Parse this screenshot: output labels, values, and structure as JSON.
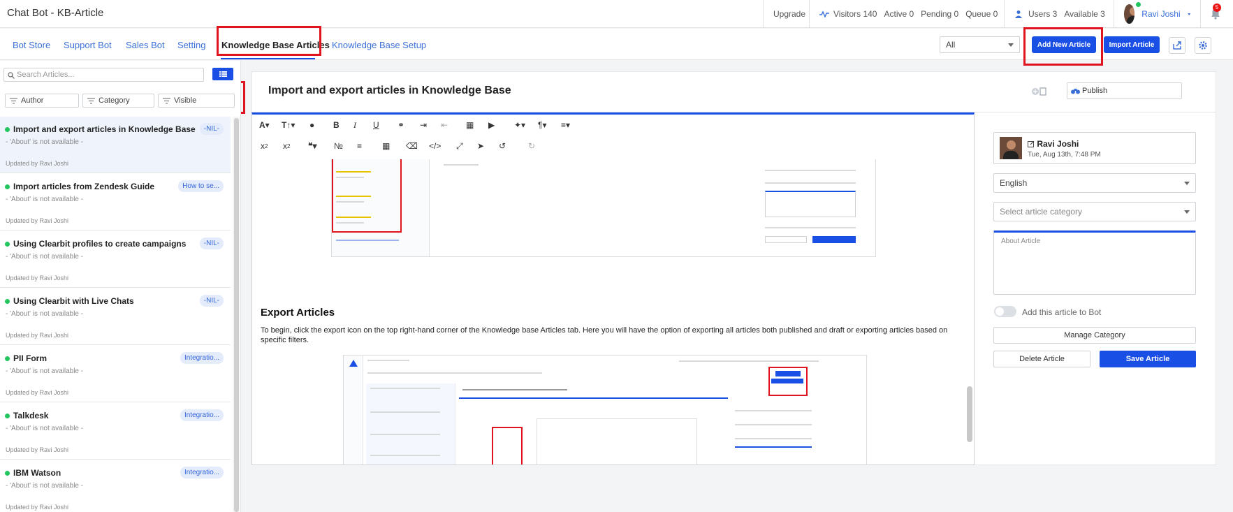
{
  "app": {
    "title": "Chat Bot - KB-Article"
  },
  "topbar": {
    "upgrade": "Upgrade",
    "visitors": "Visitors 140",
    "active": "Active 0",
    "pending": "Pending 0",
    "queue": "Queue 0",
    "users": "Users 3",
    "available": "Available 3",
    "user_name": "Ravi Joshi",
    "notifications": "5"
  },
  "tabs": [
    {
      "label": "Bot Store"
    },
    {
      "label": "Support Bot"
    },
    {
      "label": "Sales Bot"
    },
    {
      "label": "Setting"
    },
    {
      "label": "Knowledge Base Articles"
    },
    {
      "label": "Knowledge Base Setup"
    }
  ],
  "header_actions": {
    "filter_value": "All",
    "add_new_article": "Add New Article",
    "import_article": "Import Article"
  },
  "sidebar": {
    "search_placeholder": "Search Articles...",
    "filters": {
      "author": "Author",
      "category": "Category",
      "visible": "Visible"
    },
    "articles": [
      {
        "title": "Import and export articles in Knowledge Base",
        "badge": "-NIL-",
        "about": "- 'About' is not available -",
        "updated": "Updated by Ravi Joshi"
      },
      {
        "title": "Import articles from Zendesk Guide",
        "badge": "How to se...",
        "about": "- 'About' is not available -",
        "updated": "Updated by Ravi Joshi"
      },
      {
        "title": "Using Clearbit profiles to create campaigns",
        "badge": "-NIL-",
        "about": "- 'About' is not available -",
        "updated": "Updated by Ravi Joshi"
      },
      {
        "title": "Using Clearbit with Live Chats",
        "badge": "-NIL-",
        "about": "- 'About' is not available -",
        "updated": "Updated by Ravi Joshi"
      },
      {
        "title": "PII Form",
        "badge": "Integratio...",
        "about": "- 'About' is not available -",
        "updated": "Updated by Ravi Joshi"
      },
      {
        "title": "Talkdesk",
        "badge": "Integratio...",
        "about": "- 'About' is not available -",
        "updated": "Updated by Ravi Joshi"
      },
      {
        "title": "IBM Watson",
        "badge": "Integratio...",
        "about": "- 'About' is not available -",
        "updated": "Updated by Ravi Joshi"
      }
    ]
  },
  "editor": {
    "article_title": "Import and export articles in Knowledge Base",
    "publish": "Publish",
    "section_heading": "Export Articles",
    "section_paragraph": "To begin, click the export icon on the top right-hand corner of the Knowledge base Articles tab. Here you will have the option of exporting all articles both published and draft or exporting articles based on specific filters.",
    "toolbar_icons": [
      "font-icon",
      "font-size-icon",
      "color-icon",
      "bold-icon",
      "italic-icon",
      "underline-icon",
      "link-icon",
      "indent-icon",
      "outdent-icon",
      "image-icon",
      "video-icon",
      "magic-icon",
      "paragraph-icon",
      "align-icon",
      "subscript-icon",
      "superscript-icon",
      "quote-icon",
      "ordered-list-icon",
      "unordered-list-icon",
      "table-icon",
      "eraser-icon",
      "code-icon",
      "fullscreen-icon",
      "select-icon",
      "undo-icon",
      "redo-icon"
    ]
  },
  "right_panel": {
    "author_name": "Ravi Joshi",
    "author_date": "Tue, Aug 13th, 7:48 PM",
    "language": "English",
    "category_placeholder": "Select article category",
    "about_placeholder": "About Article",
    "add_to_bot": "Add this article to Bot",
    "manage_category": "Manage Category",
    "delete_article": "Delete Article",
    "save_article": "Save Article"
  },
  "colors": {
    "accent": "#1a4fe6",
    "highlight": "#e0141e",
    "online": "#22c55e"
  }
}
